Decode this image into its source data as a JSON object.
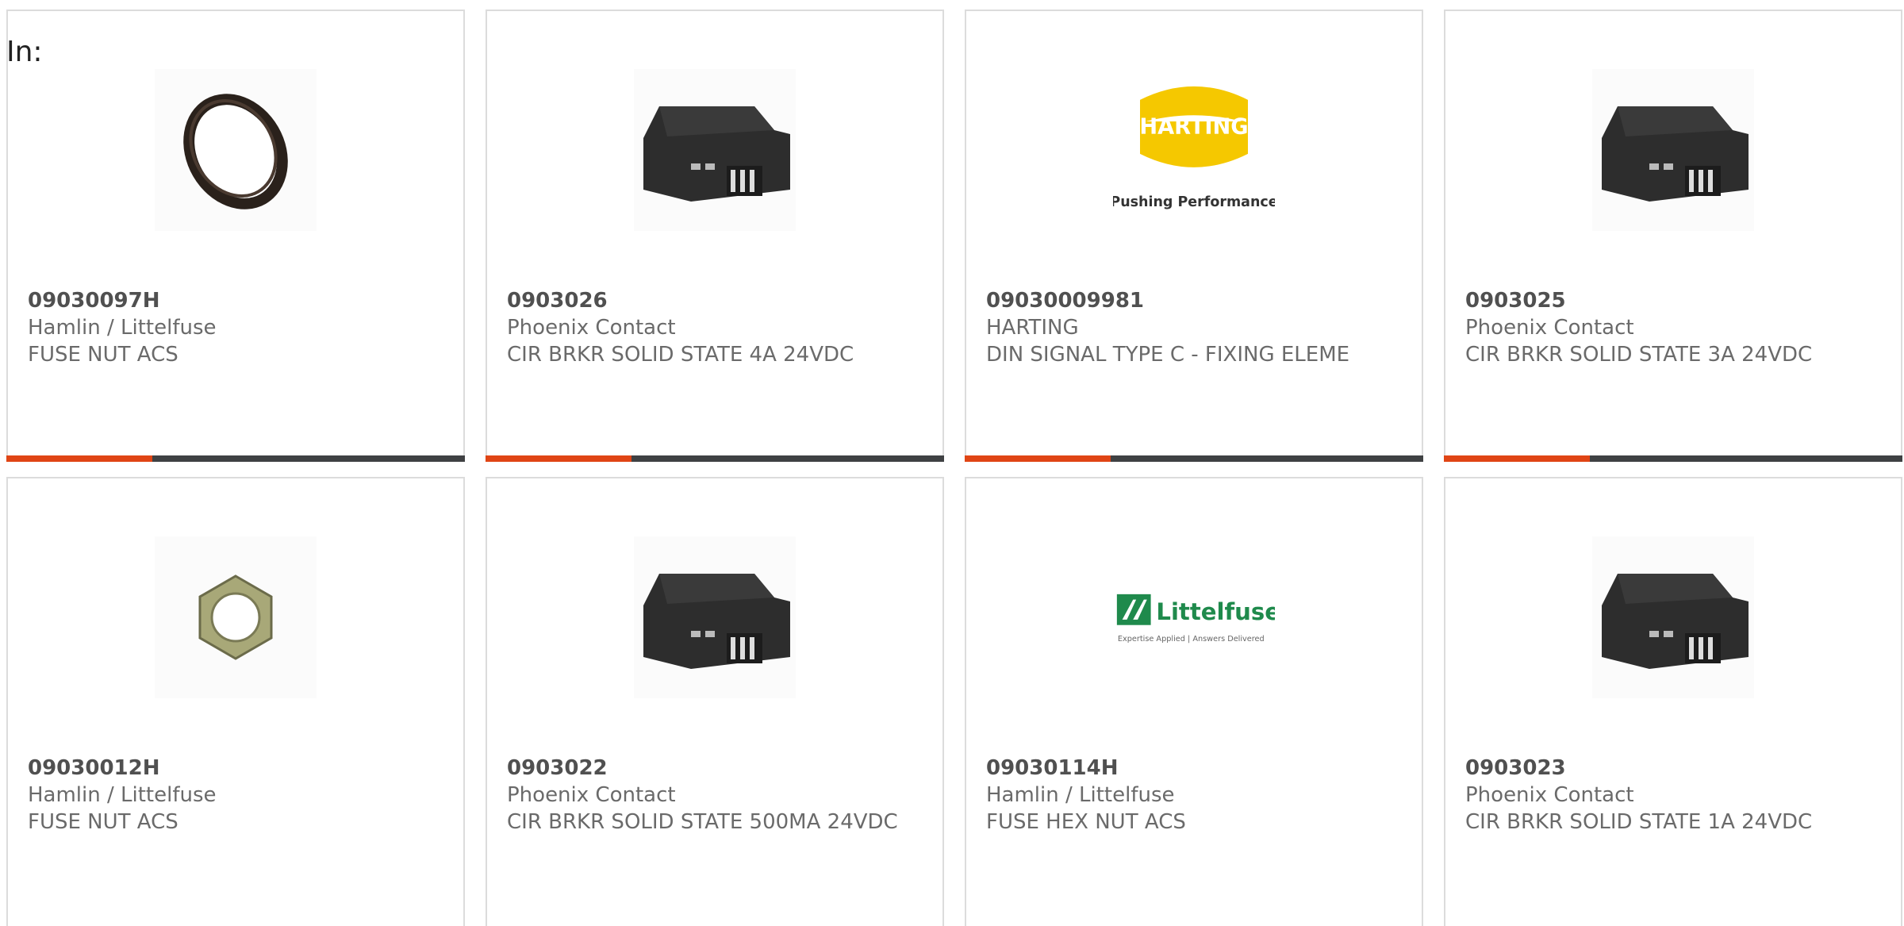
{
  "header": {
    "in_label": "In:"
  },
  "products": [
    {
      "part": "09030097H",
      "brand": "Hamlin / Littelfuse",
      "desc": "FUSE NUT ACS",
      "image": "round-nut"
    },
    {
      "part": "0903026",
      "brand": "Phoenix Contact",
      "desc": "CIR BRKR SOLID STATE 4A 24VDC",
      "image": "din-breaker"
    },
    {
      "part": "09030009981",
      "brand": "HARTING",
      "desc": "DIN SIGNAL TYPE C - FIXING ELEME",
      "image": "harting-logo",
      "logo_text": "HARTING",
      "tagline": "Pushing Performance"
    },
    {
      "part": "0903025",
      "brand": "Phoenix Contact",
      "desc": "CIR BRKR SOLID STATE 3A 24VDC",
      "image": "din-breaker"
    },
    {
      "part": "09030012H",
      "brand": "Hamlin / Littelfuse",
      "desc": "FUSE NUT ACS",
      "image": "hex-nut"
    },
    {
      "part": "0903022",
      "brand": "Phoenix Contact",
      "desc": "CIR BRKR SOLID STATE 500MA 24VDC",
      "image": "din-breaker"
    },
    {
      "part": "09030114H",
      "brand": "Hamlin / Littelfuse",
      "desc": "FUSE HEX NUT ACS",
      "image": "littelfuse-logo",
      "logo_text": "Littelfuse",
      "tagline": "Expertise Applied | Answers Delivered"
    },
    {
      "part": "0903023",
      "brand": "Phoenix Contact",
      "desc": "CIR BRKR SOLID STATE 1A 24VDC",
      "image": "din-breaker"
    }
  ],
  "colors": {
    "accent": "#e04515",
    "bar": "#3f4143",
    "border": "#dcdcdc"
  }
}
